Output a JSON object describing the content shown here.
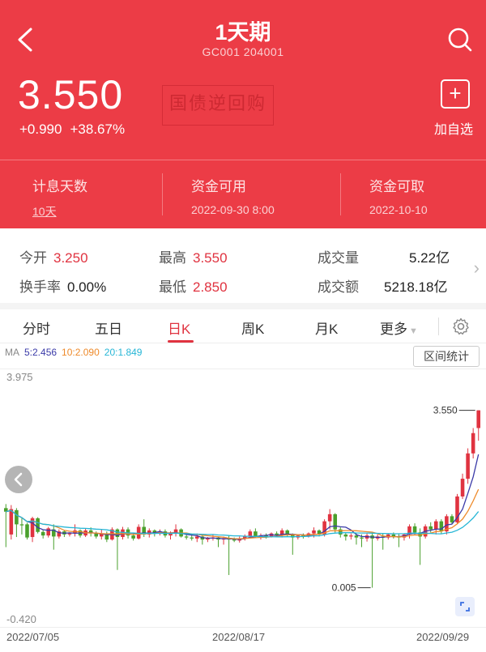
{
  "header": {
    "title": "1天期",
    "code": "GC001 204001",
    "price": "3.550",
    "change": "+0.990",
    "change_pct": "+38.67%",
    "stamp": "国债逆回购",
    "add_label": "加自选",
    "add_icon": "plus-icon",
    "info": [
      {
        "label": "计息天数",
        "value": "10天"
      },
      {
        "label": "资金可用",
        "value": "2022-09-30 8:00"
      },
      {
        "label": "资金可取",
        "value": "2022-10-10"
      }
    ]
  },
  "stats": {
    "open_label": "今开",
    "open": "3.250",
    "high_label": "最高",
    "high": "3.550",
    "volume_label": "成交量",
    "volume": "5.22亿",
    "turnover_label": "换手率",
    "turnover": "0.00%",
    "low_label": "最低",
    "low": "2.850",
    "amount_label": "成交额",
    "amount": "5218.18亿"
  },
  "tabs": [
    "分时",
    "五日",
    "日K",
    "周K",
    "月K",
    "更多"
  ],
  "active_tab": "日K",
  "ma": {
    "label": "MA",
    "ma5": "5:2.456",
    "ma10": "10:2.090",
    "ma20": "20:1.849"
  },
  "range_button": "区间统计",
  "colors": {
    "up": "#e03340",
    "down": "#4aa02c",
    "ma5": "#3a3aa8",
    "ma10": "#ee8a2a",
    "ma20": "#26b6d6",
    "brand": "#ec3c46"
  },
  "chart_data": {
    "type": "candlestick",
    "y_top_label": "3.975",
    "y_bottom_label": "-0.420",
    "ylim": [
      -0.42,
      3.975
    ],
    "max_label": "3.550",
    "min_label": "0.005",
    "x_labels": [
      "2022/07/05",
      "2022/08/17",
      "2022/09/29"
    ],
    "candles": [
      [
        1.62,
        1.7,
        0.85,
        1.55
      ],
      [
        1.1,
        1.68,
        1.0,
        1.6
      ],
      [
        1.58,
        1.62,
        1.05,
        1.3
      ],
      [
        1.3,
        1.42,
        1.1,
        1.28
      ],
      [
        1.3,
        1.33,
        1.0,
        1.04
      ],
      [
        1.05,
        1.45,
        0.95,
        1.42
      ],
      [
        1.42,
        1.44,
        1.12,
        1.15
      ],
      [
        1.15,
        1.2,
        1.02,
        1.08
      ],
      [
        1.08,
        1.25,
        1.04,
        1.22
      ],
      [
        1.2,
        1.3,
        0.8,
        1.06
      ],
      [
        1.06,
        1.2,
        1.02,
        1.16
      ],
      [
        1.16,
        1.18,
        1.05,
        1.1
      ],
      [
        1.1,
        1.14,
        1.06,
        1.12
      ],
      [
        1.12,
        1.3,
        1.06,
        1.18
      ],
      [
        1.18,
        1.2,
        1.04,
        1.08
      ],
      [
        1.08,
        1.22,
        1.05,
        1.18
      ],
      [
        1.18,
        1.24,
        1.06,
        1.12
      ],
      [
        1.12,
        1.16,
        1.02,
        1.06
      ],
      [
        1.06,
        1.2,
        1.0,
        1.12
      ],
      [
        1.12,
        1.16,
        0.95,
        1.0
      ],
      [
        1.0,
        1.24,
        0.98,
        1.2
      ],
      [
        1.2,
        1.22,
        0.4,
        1.05
      ],
      [
        1.05,
        1.25,
        1.0,
        1.2
      ],
      [
        1.2,
        1.24,
        1.02,
        1.08
      ],
      [
        1.08,
        1.12,
        0.98,
        1.02
      ],
      [
        1.02,
        1.3,
        1.0,
        1.25
      ],
      [
        1.25,
        1.4,
        1.05,
        1.1
      ],
      [
        1.1,
        1.22,
        1.04,
        1.18
      ],
      [
        1.18,
        1.2,
        1.06,
        1.12
      ],
      [
        1.12,
        1.2,
        1.08,
        1.16
      ],
      [
        1.16,
        1.2,
        1.04,
        1.08
      ],
      [
        1.08,
        1.16,
        1.0,
        1.12
      ],
      [
        1.12,
        1.3,
        1.06,
        1.2
      ],
      [
        1.2,
        1.22,
        1.04,
        1.06
      ],
      [
        1.06,
        1.12,
        1.0,
        1.04
      ],
      [
        1.04,
        1.1,
        0.98,
        1.02
      ],
      [
        1.02,
        1.12,
        0.95,
        1.06
      ],
      [
        1.06,
        1.1,
        0.9,
        1.0
      ],
      [
        1.0,
        1.05,
        0.95,
        1.02
      ],
      [
        1.02,
        1.1,
        0.98,
        1.04
      ],
      [
        1.04,
        1.06,
        0.85,
        1.0
      ],
      [
        1.0,
        1.06,
        0.9,
        1.02
      ],
      [
        1.02,
        1.08,
        0.3,
        1.0
      ],
      [
        1.0,
        1.04,
        0.95,
        0.98
      ],
      [
        0.98,
        1.06,
        0.94,
        1.02
      ],
      [
        1.02,
        1.1,
        0.98,
        1.06
      ],
      [
        1.06,
        1.2,
        1.02,
        1.16
      ],
      [
        1.16,
        1.22,
        1.04,
        1.06
      ],
      [
        1.06,
        1.12,
        1.0,
        1.08
      ],
      [
        1.08,
        1.12,
        1.02,
        1.06
      ],
      [
        1.06,
        1.14,
        1.04,
        1.12
      ],
      [
        1.12,
        1.16,
        1.05,
        1.08
      ],
      [
        1.08,
        1.22,
        1.04,
        1.18
      ],
      [
        1.18,
        1.2,
        1.06,
        1.1
      ],
      [
        1.1,
        1.12,
        0.7,
        1.04
      ],
      [
        1.04,
        1.1,
        1.0,
        1.08
      ],
      [
        1.08,
        1.12,
        1.02,
        1.06
      ],
      [
        1.06,
        1.14,
        1.04,
        1.12
      ],
      [
        1.12,
        1.24,
        1.04,
        1.18
      ],
      [
        1.18,
        1.2,
        1.06,
        1.1
      ],
      [
        1.1,
        1.4,
        1.06,
        1.36
      ],
      [
        1.36,
        1.6,
        1.2,
        1.5
      ],
      [
        1.5,
        1.52,
        1.14,
        1.2
      ],
      [
        1.2,
        1.24,
        1.04,
        1.1
      ],
      [
        1.1,
        1.14,
        0.98,
        1.06
      ],
      [
        1.06,
        1.12,
        1.0,
        1.08
      ],
      [
        1.08,
        1.12,
        0.9,
        1.04
      ],
      [
        1.04,
        1.1,
        0.85,
        1.02
      ],
      [
        1.02,
        1.12,
        0.96,
        1.08
      ],
      [
        1.08,
        1.14,
        0.05,
        1.02
      ],
      [
        1.02,
        1.1,
        0.98,
        1.06
      ],
      [
        1.06,
        1.12,
        0.8,
        1.04
      ],
      [
        1.04,
        1.12,
        1.0,
        1.1
      ],
      [
        1.1,
        1.14,
        1.02,
        1.06
      ],
      [
        1.06,
        1.12,
        0.85,
        1.04
      ],
      [
        1.04,
        1.12,
        0.98,
        1.1
      ],
      [
        1.1,
        1.3,
        1.02,
        1.26
      ],
      [
        1.26,
        1.32,
        1.1,
        1.14
      ],
      [
        1.14,
        1.22,
        0.5,
        1.06
      ],
      [
        1.06,
        1.3,
        1.02,
        1.26
      ],
      [
        1.26,
        1.34,
        1.14,
        1.2
      ],
      [
        1.2,
        1.4,
        1.1,
        1.36
      ],
      [
        1.36,
        1.4,
        1.12,
        1.16
      ],
      [
        1.16,
        1.5,
        1.1,
        1.46
      ],
      [
        1.46,
        1.5,
        1.3,
        1.34
      ],
      [
        1.34,
        1.9,
        1.3,
        1.85
      ],
      [
        1.85,
        2.3,
        1.8,
        2.2
      ],
      [
        2.2,
        2.8,
        2.1,
        2.7
      ],
      [
        2.7,
        3.2,
        2.6,
        3.1
      ],
      [
        3.2,
        3.55,
        2.95,
        3.55
      ]
    ]
  }
}
